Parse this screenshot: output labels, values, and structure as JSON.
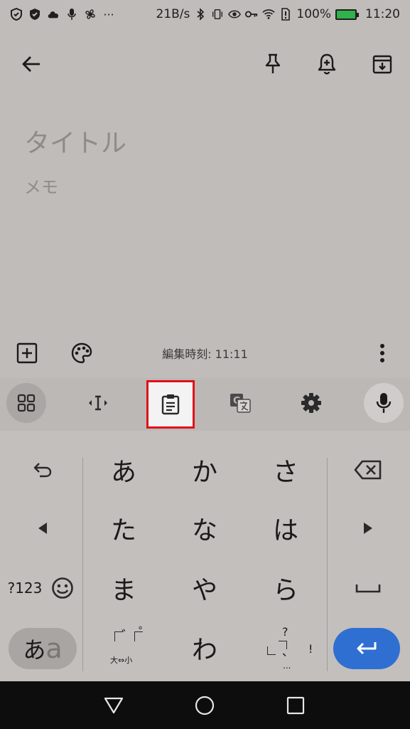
{
  "status_bar": {
    "speed": "21B/s",
    "battery_percent": "100%",
    "time": "11:20",
    "battery_color": "#2fb24c",
    "icons": [
      "shield-icon",
      "shield-filled-icon",
      "cloud-icon",
      "mic-icon",
      "fan-icon",
      "more-icon",
      "bluetooth-icon",
      "vibrate-icon",
      "eye-icon",
      "key-icon",
      "wifi-icon",
      "sim-alert-icon",
      "battery-icon"
    ]
  },
  "app_bar": {
    "icons": [
      "back-arrow-icon",
      "pin-icon",
      "reminder-icon",
      "archive-icon"
    ]
  },
  "note": {
    "title_placeholder": "タイトル",
    "body_placeholder": "メモ"
  },
  "note_toolbar": {
    "edit_time": "編集時刻: 11:11",
    "icons": [
      "add-box-icon",
      "palette-icon",
      "more-vert-icon"
    ]
  },
  "keyboard": {
    "toolbar_icons": [
      "apps-grid-icon",
      "cursor-move-icon",
      "clipboard-icon",
      "translate-icon",
      "settings-gear-icon",
      "microphone-icon"
    ],
    "highlight_color": "#e0101a",
    "rows": [
      [
        "あ",
        "か",
        "さ"
      ],
      [
        "た",
        "な",
        "は"
      ],
      [
        "ま",
        "や",
        "ら"
      ],
      [
        "",
        "わ",
        ""
      ]
    ],
    "symbols_label": "?123",
    "mode_label": "あa",
    "dakuten_label": "大⇔小",
    "punct_top": "?",
    "punct_right": "!",
    "punct_bottom": "...",
    "enter_color": "#2f6fd1"
  },
  "nav_bar": {
    "icons": [
      "back-triangle-icon",
      "home-circle-icon",
      "recents-square-icon"
    ]
  }
}
